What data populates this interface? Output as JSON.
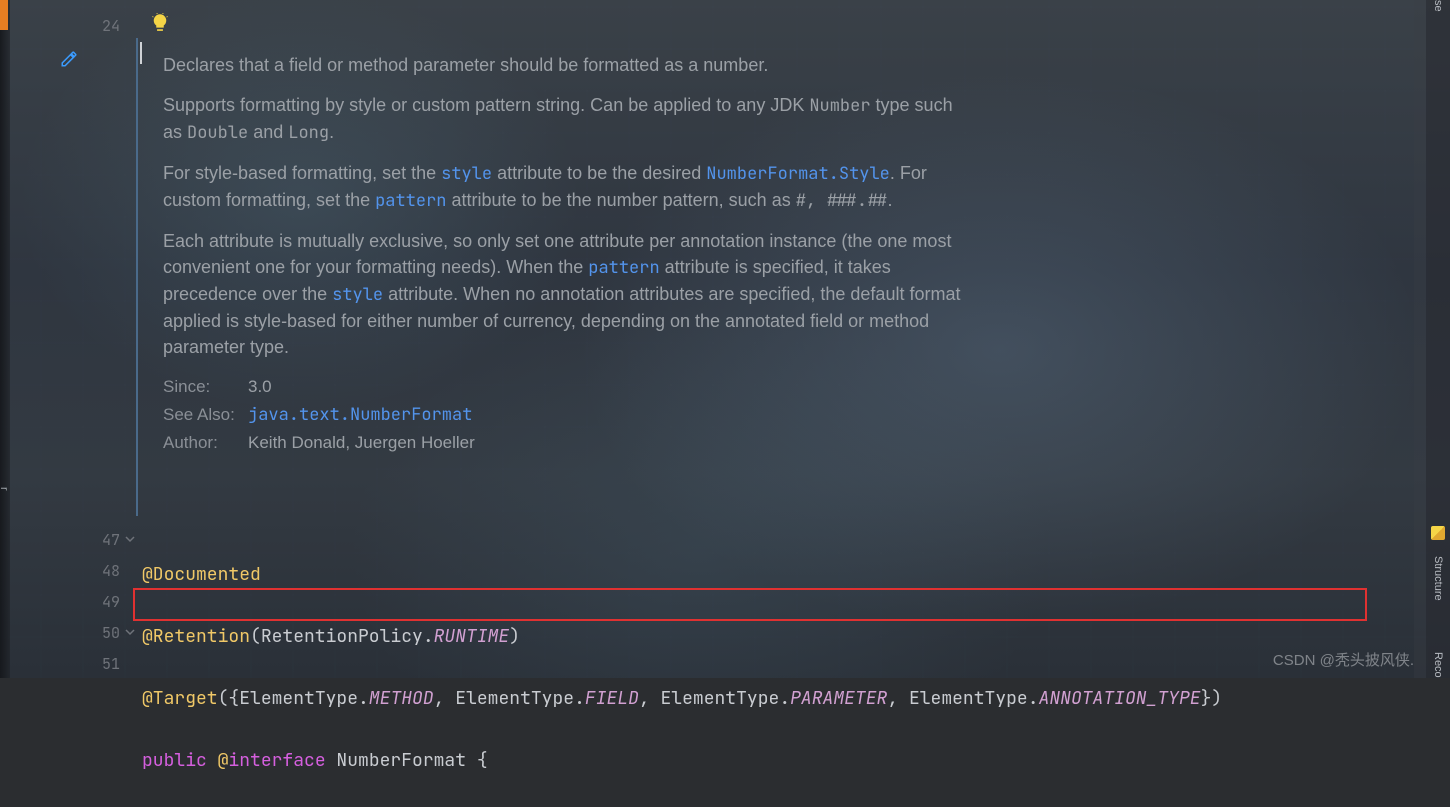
{
  "gutter": {
    "line_24": "24",
    "line_47": "47",
    "line_48": "48",
    "line_49": "49",
    "line_50": "50",
    "line_51": "51"
  },
  "left_edge_text": "r",
  "doc": {
    "p1": "Declares that a field or method parameter should be formatted as a number.",
    "p2_a": "Supports formatting by style or custom pattern string. Can be applied to any JDK ",
    "p2_number": "Number",
    "p2_b": " type such as ",
    "p2_double": "Double",
    "p2_c": " and ",
    "p2_long": "Long",
    "p2_d": ".",
    "p3_a": "For style-based formatting, set the ",
    "p3_style": "style",
    "p3_b": " attribute to be the desired ",
    "p3_nfstyle": "NumberFormat.Style",
    "p3_c": ". For custom formatting, set the ",
    "p3_pattern": "pattern",
    "p3_d": " attribute to be the number pattern, such as ",
    "p3_e": "#, ###.##",
    "p3_f": ".",
    "p4_a": "Each attribute is mutually exclusive, so only set one attribute per annotation instance (the one most convenient one for your formatting needs). When the ",
    "p4_pattern": "pattern",
    "p4_b": " attribute is specified, it takes precedence over the ",
    "p4_style": "style",
    "p4_c": " attribute. When no annotation attributes are specified, the default format applied is style-based for either number of currency, depending on the annotated field or method parameter type.",
    "since_label": "Since:",
    "since_val": "3.0",
    "seealso_label": "See Also:",
    "seealso_val": "java.text.NumberFormat",
    "author_label": "Author:",
    "author_val": "Keith Donald, Juergen Hoeller"
  },
  "code": {
    "l47": {
      "a": "@Documented"
    },
    "l48": {
      "a": "@Retention",
      "p1": "(",
      "b": "RetentionPolicy",
      "dot": ".",
      "c": "RUNTIME",
      "p2": ")"
    },
    "l49": {
      "a": "@Target",
      "p1": "({",
      "b1": "ElementType",
      "d1": ".",
      "c1": "METHOD",
      "s1": ", ",
      "b2": "ElementType",
      "d2": ".",
      "c2": "FIELD",
      "s2": ", ",
      "b3": "ElementType",
      "d3": ".",
      "c3": "PARAMETER",
      "s3": ", ",
      "b4": "ElementType",
      "d4": ".",
      "c4": "ANNOTATION_TYPE",
      "p2": "})"
    },
    "l50": {
      "pub": "public ",
      "at": "@",
      "intf": "interface ",
      "name": "NumberFormat ",
      "brace": "{"
    }
  },
  "right": {
    "t1": "se",
    "t2": "Structure",
    "t3": "Reco"
  },
  "watermark": "CSDN @秃头披风侠."
}
